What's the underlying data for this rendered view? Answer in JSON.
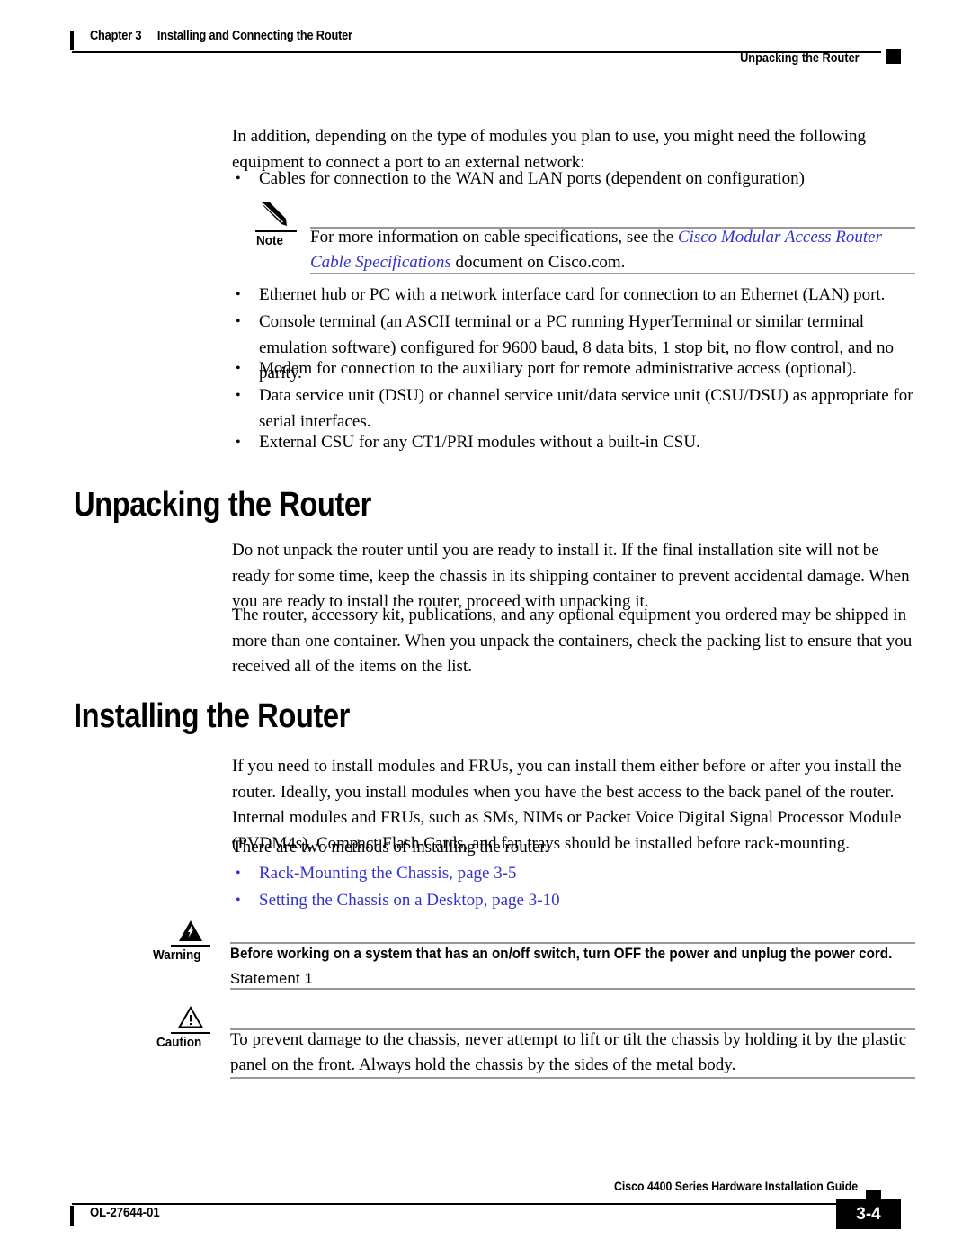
{
  "header": {
    "chapter_label": "Chapter 3",
    "chapter_title": "Installing and Connecting the Router",
    "section_title": "Unpacking the Router"
  },
  "content": {
    "intro_paragraph": "In addition, depending on the type of modules you plan to use, you might need the following equipment to connect a port to an external network:",
    "bullet_cables": "Cables for connection to the WAN and LAN ports (dependent on configuration)",
    "note": {
      "label": "Note",
      "icon": "pencil-icon",
      "text_before_link": "For more information on cable specifications, see the ",
      "link_text": "Cisco Modular Access Router Cable Specifications",
      "text_after_link": " document on Cisco.com."
    },
    "bullets_equipment": [
      "Ethernet hub or PC with a network interface card for connection to an Ethernet (LAN) port.",
      "Console terminal (an ASCII terminal or a PC running HyperTerminal or similar terminal emulation software) configured for 9600 baud, 8 data bits, 1 stop bit, no flow control, and no parity.",
      "Modem for connection to the auxiliary port for remote administrative access (optional).",
      "Data service unit (DSU) or channel service unit/data service unit (CSU/DSU) as appropriate for serial interfaces.",
      "External CSU for any CT1/PRI modules without a built-in CSU."
    ],
    "unpacking": {
      "heading": "Unpacking the Router",
      "paragraph_1": "Do not unpack the router until you are ready to install it. If the final installation site will not be ready for some time, keep the chassis in its shipping container to prevent accidental damage. When you are ready to install the router, proceed with unpacking it.",
      "paragraph_2": "The router, accessory kit, publications, and any optional equipment you ordered may be shipped in more than one container. When you unpack the containers, check the packing list to ensure that you received all of the items on the list."
    },
    "installing": {
      "heading": "Installing the Router",
      "paragraph_1": "If you need to install modules and FRUs, you can install them either before or after you install the router. Ideally, you install modules when you have the best access to the back panel of the router. Internal modules and FRUs, such as SMs, NIMs or Packet Voice Digital Signal Processor Module (PVDM4s), Compact Flash Cards, and fan trays should be installed before rack-mounting.",
      "paragraph_2": "There are two methods of installing the router:",
      "links": [
        "Rack-Mounting the Chassis, page 3-5",
        "Setting the Chassis on a Desktop, page 3-10"
      ]
    },
    "warning": {
      "label": "Warning",
      "icon": "warning-lightning-triangle-icon",
      "text_bold": "Before working on a system that has an on/off switch, turn OFF the power and unplug the power cord.",
      "statement": "Statement 1"
    },
    "caution": {
      "label": "Caution",
      "icon": "caution-exclamation-triangle-icon",
      "text": "To prevent damage to the chassis, never attempt to lift or tilt the chassis by holding it by the plastic panel on the front. Always hold the chassis by the sides of the metal body."
    }
  },
  "footer": {
    "guide_title": "Cisco 4400 Series Hardware Installation Guide",
    "doc_number": "OL-27644-01",
    "page_number": "3-4"
  },
  "colors": {
    "link_blue": "#3333cc",
    "rule_gray": "#999999",
    "text_black": "#000000"
  }
}
